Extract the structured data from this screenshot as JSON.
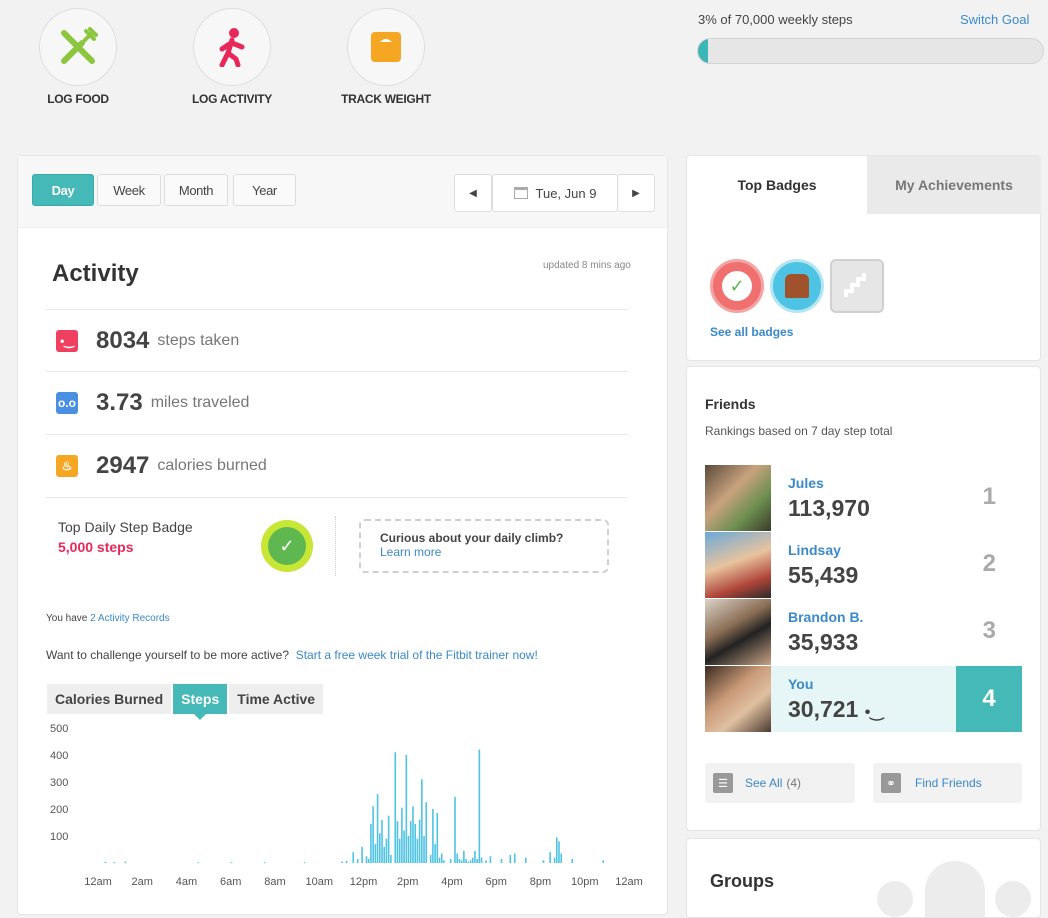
{
  "quick_actions": [
    {
      "label": "LOG FOOD",
      "icon": "fork-knife-icon",
      "color": "#8cc63f"
    },
    {
      "label": "LOG ACTIVITY",
      "icon": "walking-person-icon",
      "color": "#e8285a"
    },
    {
      "label": "TRACK WEIGHT",
      "icon": "scale-icon",
      "color": "#f5a623"
    }
  ],
  "goal": {
    "text": "3% of 70,000 weekly steps",
    "switch_label": "Switch Goal",
    "progress_percent": 3
  },
  "period_tabs": {
    "day": "Day",
    "week": "Week",
    "month": "Month",
    "year": "Year",
    "selected": "Day"
  },
  "date": {
    "label": "Tue, Jun 9"
  },
  "activity": {
    "title": "Activity",
    "updated": "updated 8 mins ago",
    "stats": [
      {
        "value": "8034",
        "unit": "steps taken",
        "icon": "footprint-icon",
        "color": "#f0405f"
      },
      {
        "value": "3.73",
        "unit": "miles traveled",
        "icon": "distance-icon",
        "color": "#4a90e2"
      },
      {
        "value": "2947",
        "unit": "calories burned",
        "icon": "flame-icon",
        "color": "#f5a623"
      }
    ],
    "badge_label": "Top Daily Step Badge",
    "badge_steps": "5,000 steps",
    "climb_question": "Curious about your daily climb?",
    "climb_link": "Learn more",
    "records_prefix": "You have ",
    "records_link": "2 Activity Records",
    "challenge_text": "Want to challenge yourself to be more active?",
    "challenge_link": "Start a free week trial of the Fitbit trainer now!"
  },
  "chart_tabs": {
    "calories": "Calories Burned",
    "steps": "Steps",
    "time": "Time Active",
    "selected": "Steps"
  },
  "chart_data": {
    "type": "bar",
    "title": "",
    "xlabel": "",
    "ylabel": "",
    "ylim": [
      0,
      500
    ],
    "yticks": [
      "500",
      "400",
      "300",
      "200",
      "100"
    ],
    "xticks": [
      "12am",
      "2am",
      "4am",
      "6am",
      "8am",
      "10am",
      "12pm",
      "2pm",
      "4pm",
      "6pm",
      "8pm",
      "10pm",
      "12am"
    ],
    "color": "#4fc3e3",
    "x": [
      0.3,
      0.7,
      1.2,
      4.5,
      6.0,
      7.5,
      9.3,
      11.0,
      11.2,
      11.5,
      11.7,
      11.9,
      12.1,
      12.2,
      12.3,
      12.4,
      12.5,
      12.6,
      12.7,
      12.8,
      12.9,
      13.0,
      13.1,
      13.2,
      13.4,
      13.5,
      13.6,
      13.7,
      13.8,
      13.9,
      14.0,
      14.1,
      14.2,
      14.3,
      14.4,
      14.5,
      14.6,
      14.7,
      14.8,
      15.0,
      15.1,
      15.2,
      15.3,
      15.4,
      15.5,
      15.6,
      15.9,
      16.1,
      16.2,
      16.3,
      16.4,
      16.5,
      16.6,
      16.7,
      16.8,
      16.9,
      17.0,
      17.1,
      17.2,
      17.3,
      17.5,
      17.7,
      18.2,
      18.6,
      18.8,
      19.3,
      20.1,
      20.4,
      20.6,
      20.7,
      20.8,
      20.9,
      21.4,
      22.8
    ],
    "y": [
      4,
      3,
      5,
      3,
      3,
      3,
      3,
      5,
      8,
      40,
      15,
      60,
      25,
      15,
      145,
      210,
      70,
      255,
      110,
      160,
      60,
      90,
      175,
      30,
      410,
      155,
      90,
      205,
      120,
      400,
      100,
      155,
      210,
      145,
      90,
      160,
      310,
      100,
      225,
      30,
      200,
      70,
      185,
      20,
      35,
      10,
      15,
      245,
      35,
      15,
      10,
      45,
      15,
      5,
      10,
      20,
      45,
      15,
      420,
      20,
      10,
      25,
      15,
      30,
      35,
      20,
      10,
      40,
      20,
      95,
      80,
      35,
      15,
      10
    ]
  },
  "badges_panel": {
    "tab_top": "Top Badges",
    "tab_achievements": "My Achievements",
    "see_all": "See all badges"
  },
  "friends": {
    "title": "Friends",
    "subtitle": "Rankings based on 7 day step total",
    "list": [
      {
        "name": "Jules",
        "steps": "113,970",
        "rank": "1"
      },
      {
        "name": "Lindsay",
        "steps": "55,439",
        "rank": "2"
      },
      {
        "name": "Brandon B.",
        "steps": "35,933",
        "rank": "3"
      },
      {
        "name": "You",
        "steps": "30,721",
        "rank": "4"
      }
    ],
    "see_all_label": "See All",
    "see_all_count": "(4)",
    "find_friends": "Find Friends"
  },
  "groups": {
    "title": "Groups"
  },
  "colors": {
    "teal": "#45b8b8",
    "link": "#3a89c9",
    "pink": "#e8285a"
  }
}
